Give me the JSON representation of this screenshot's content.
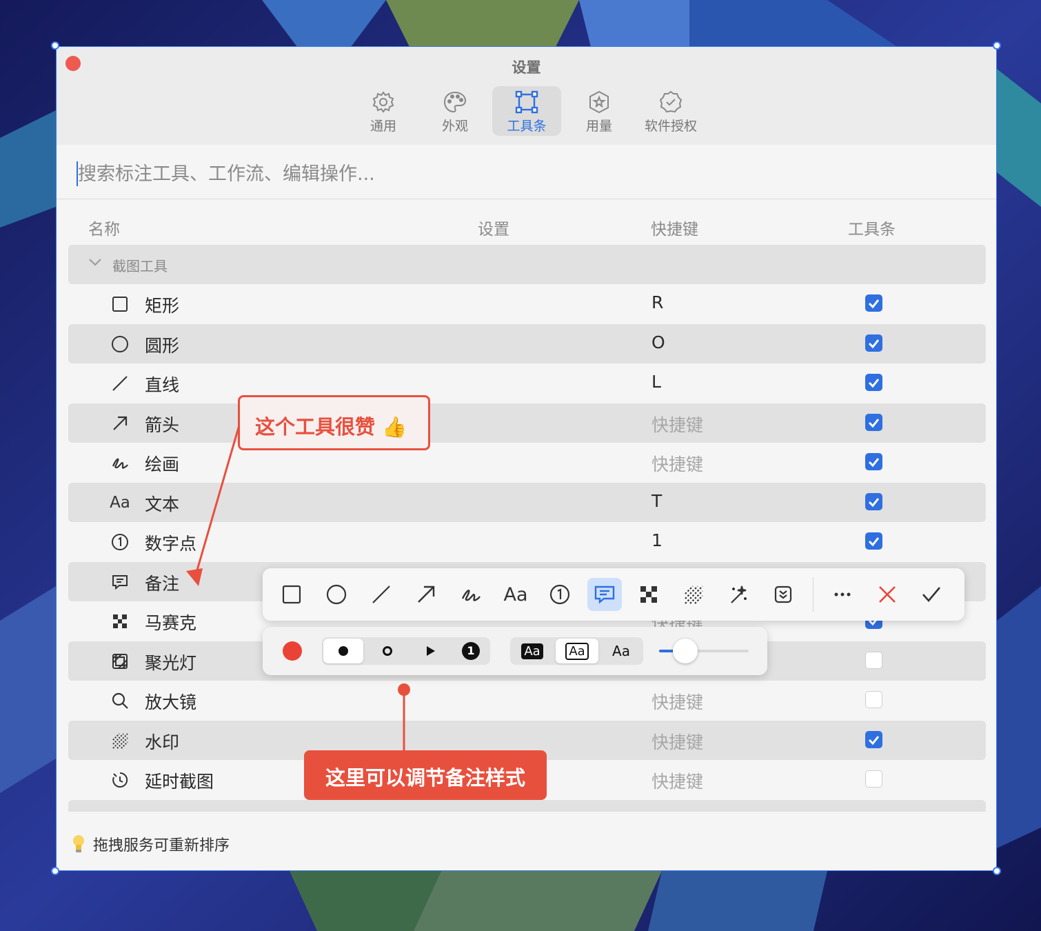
{
  "window": {
    "title": "设置"
  },
  "tabs": [
    {
      "label": "通用",
      "icon": "gear-icon"
    },
    {
      "label": "外观",
      "icon": "palette-icon"
    },
    {
      "label": "工具条",
      "icon": "toolbar-frame-icon",
      "active": true
    },
    {
      "label": "用量",
      "icon": "badge-star-icon"
    },
    {
      "label": "软件授权",
      "icon": "badge-check-icon"
    }
  ],
  "search": {
    "placeholder": "搜索标注工具、工作流、编辑操作..."
  },
  "columns": {
    "name": "名称",
    "settings": "设置",
    "shortcut": "快捷键",
    "toolbar": "工具条"
  },
  "group": {
    "label": "截图工具",
    "expanded": true
  },
  "rows": [
    {
      "name": "矩形",
      "icon": "rectangle-icon",
      "shortcut": "R",
      "placeholder": false,
      "checked": true
    },
    {
      "name": "圆形",
      "icon": "circle-icon",
      "shortcut": "O",
      "placeholder": false,
      "checked": true
    },
    {
      "name": "直线",
      "icon": "line-icon",
      "shortcut": "L",
      "placeholder": false,
      "checked": true
    },
    {
      "name": "箭头",
      "icon": "arrow-icon",
      "shortcut": "快捷键",
      "placeholder": true,
      "checked": true
    },
    {
      "name": "绘画",
      "icon": "scribble-icon",
      "shortcut": "快捷键",
      "placeholder": true,
      "checked": true
    },
    {
      "name": "文本",
      "icon": "text-icon",
      "shortcut": "T",
      "placeholder": false,
      "checked": true
    },
    {
      "name": "数字点",
      "icon": "number-icon",
      "shortcut": "1",
      "placeholder": false,
      "checked": true
    },
    {
      "name": "备注",
      "icon": "comment-icon",
      "shortcut": "",
      "placeholder": true,
      "checked": true
    },
    {
      "name": "马赛克",
      "icon": "mosaic-icon",
      "shortcut": "快捷键",
      "placeholder": true,
      "checked": true
    },
    {
      "name": "聚光灯",
      "icon": "spotlight-icon",
      "shortcut": "",
      "placeholder": true,
      "checked": false
    },
    {
      "name": "放大镜",
      "icon": "magnifier-icon",
      "shortcut": "快捷键",
      "placeholder": true,
      "checked": false
    },
    {
      "name": "水印",
      "icon": "watermark-icon",
      "shortcut": "快捷键",
      "placeholder": true,
      "checked": true
    },
    {
      "name": "延时截图",
      "icon": "timer-icon",
      "shortcut": "快捷键",
      "placeholder": true,
      "checked": false
    }
  ],
  "footer": {
    "hint": "拖拽服务可重新排序",
    "icon": "lightbulb-icon"
  },
  "floating_toolbar": {
    "tools": [
      "rectangle-icon",
      "circle-icon",
      "line-icon",
      "arrow-icon",
      "scribble-icon",
      "text-icon",
      "number-icon",
      "comment-icon",
      "mosaic-icon",
      "watermark-icon",
      "magic-wand-icon",
      "save-icon"
    ],
    "active_tool": "comment-icon",
    "text_tool_label": "Aa",
    "actions": [
      "more-icon",
      "cancel-icon",
      "confirm-icon"
    ]
  },
  "style_bar": {
    "color": "#ea4335",
    "text_labels": [
      "Aa",
      "Aa",
      "Aa"
    ],
    "number_badge": "1",
    "slider_value": 0.2
  },
  "annotations": {
    "top": "这个工具很赞 👍",
    "bottom": "这里可以调节备注样式"
  },
  "colors": {
    "accent": "#2f6fe0",
    "callout": "#e8503e",
    "close": "#ee5a50"
  }
}
